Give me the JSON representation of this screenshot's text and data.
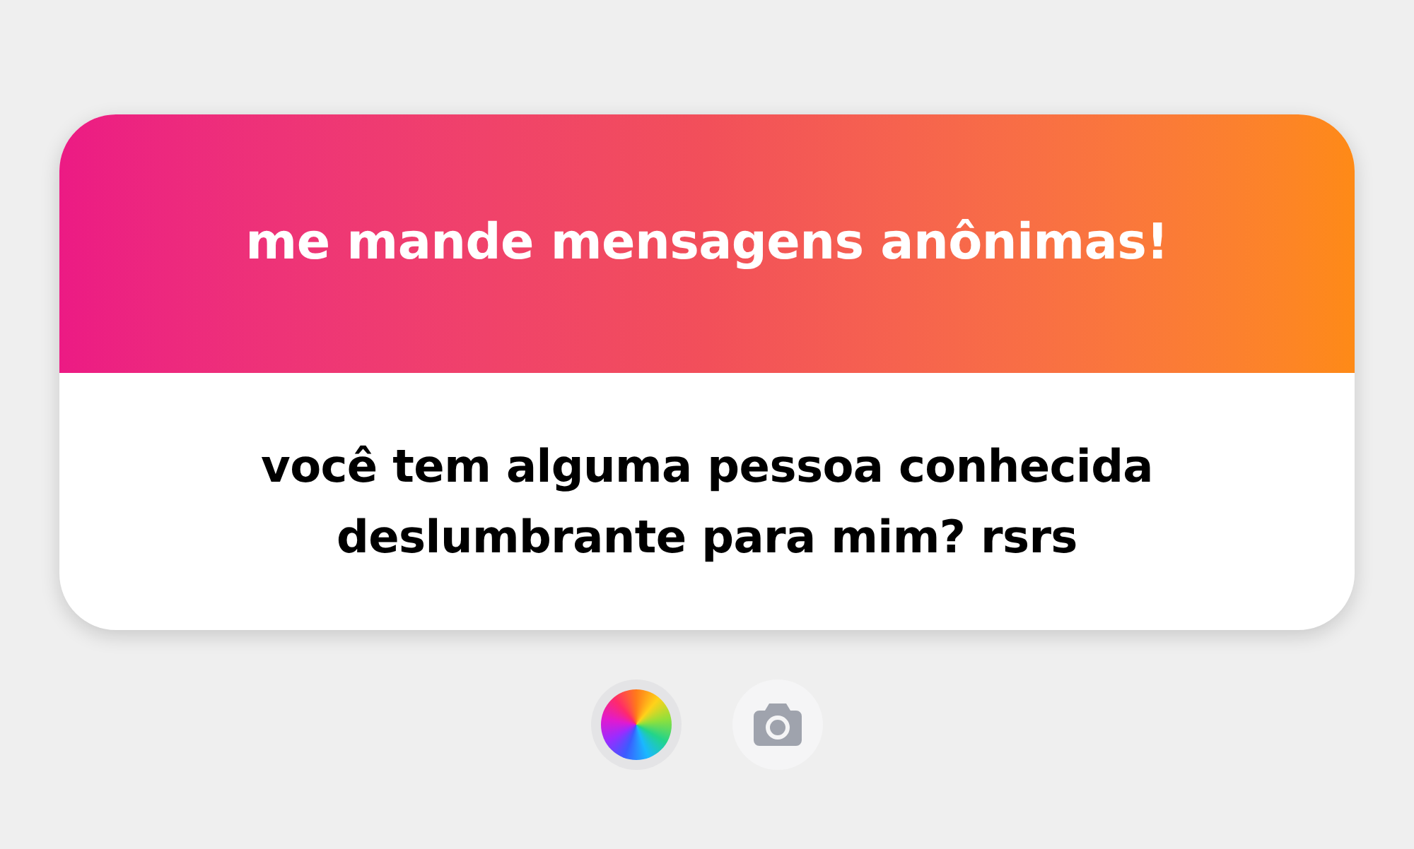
{
  "card": {
    "title": "me mande mensagens anônimas!",
    "message": "você tem alguma pessoa conhecida deslumbrante para mim? rsrs"
  },
  "tools": [
    {
      "kind": "color",
      "selected": true
    },
    {
      "kind": "camera",
      "selected": false
    }
  ]
}
